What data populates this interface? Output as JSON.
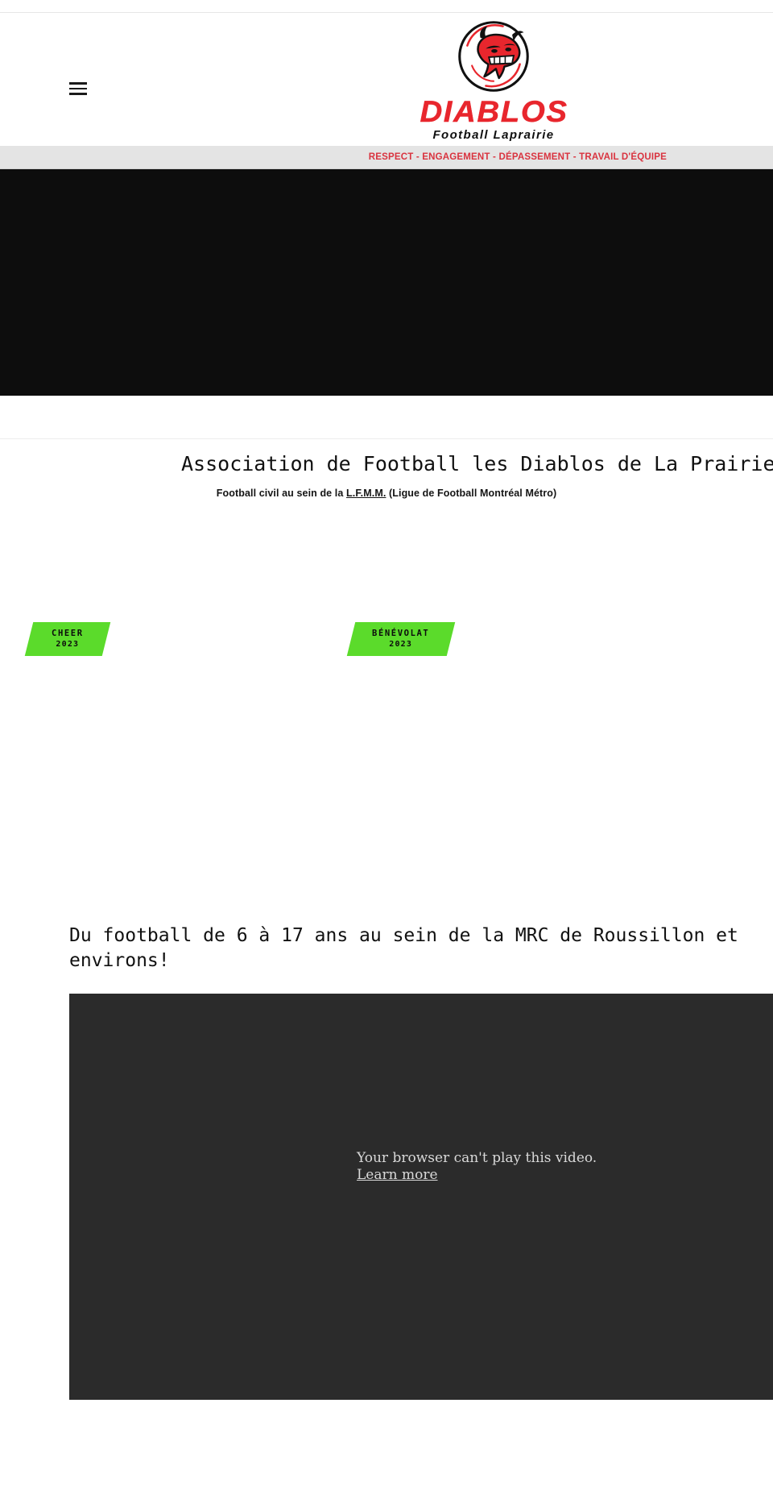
{
  "header": {
    "menu_icon": "hamburger-menu-icon",
    "brand": {
      "crest_icon": "diablos-devil-head-crest-icon",
      "wordmark": "DIABLOS",
      "tagline": "Football Laprairie"
    }
  },
  "values_bar": {
    "text": "RESPECT - ENGAGEMENT - DÉPASSEMENT - TRAVAIL D'ÉQUIPE",
    "background": "#e4e4e4",
    "text_color": "#d9333f"
  },
  "hero": {
    "background": "#0d0d0d"
  },
  "intro": {
    "title": "Association de Football les Diablos de La Prairie",
    "subtitle_pre": "Football civil au sein de la ",
    "subtitle_underlined": "L.F.M.M.",
    "subtitle_post": " (Ligue de Football Montréal Métro)"
  },
  "chips": [
    {
      "label": "CHEER",
      "year": "2023",
      "color": "#5bdb2b"
    },
    {
      "label": "BÉNÉVOLAT",
      "year": "2023",
      "color": "#5bdb2b"
    }
  ],
  "section": {
    "heading": "Du football de 6 à 17 ans au sein de la MRC de Roussillon et\nenvirons!"
  },
  "video": {
    "background": "#2b2b2b",
    "error_message": "Your browser can't play this video.",
    "learn_more_label": "Learn more"
  }
}
